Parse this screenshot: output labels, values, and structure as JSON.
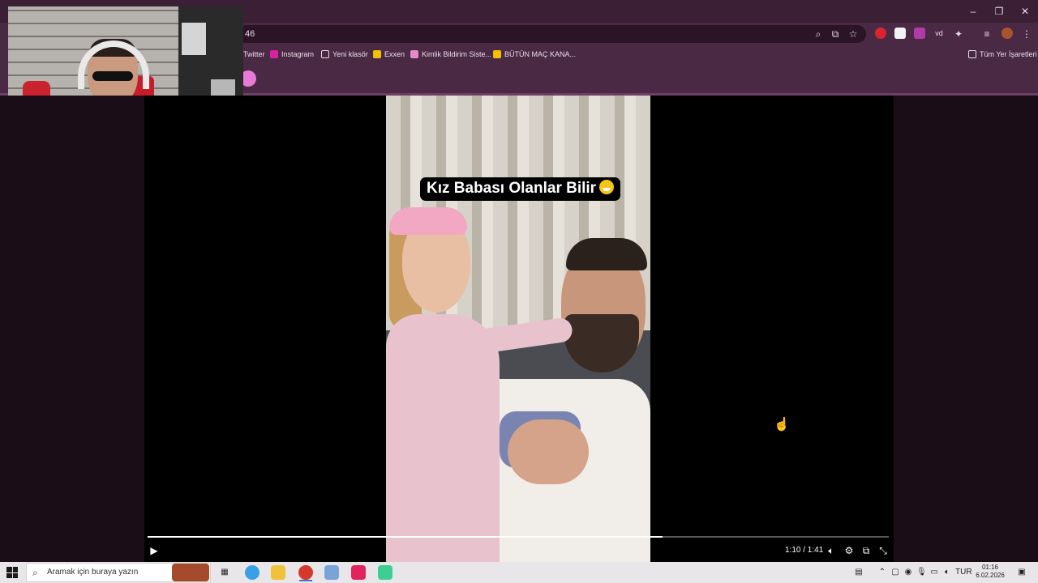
{
  "browser": {
    "address_fragment": "46",
    "window_controls": {
      "minimize": "–",
      "restore": "❐",
      "close": "✕"
    },
    "bookmarks": [
      {
        "label": "Twitter",
        "icon": "twitter-icon"
      },
      {
        "label": "Instagram",
        "icon": "instagram-icon",
        "color": "#d6249f"
      },
      {
        "label": "Yeni klasör",
        "icon": "folder-icon"
      },
      {
        "label": "Exxen",
        "icon": "exxen-icon",
        "color": "#f2c200"
      },
      {
        "label": "Kimlik Bildirim Siste...",
        "icon": "kimlik-icon",
        "color": "#e58bc7"
      },
      {
        "label": "BÜTÜN MAÇ KANA...",
        "icon": "jp-icon",
        "color": "#f2c200"
      }
    ],
    "all_bookmarks_label": "Tüm Yer İşaretleri"
  },
  "video": {
    "caption": "Kız Babası Olanlar Bilir",
    "time_display": "1:10 / 1:41",
    "progress_fraction": 0.695
  },
  "taskbar": {
    "search_placeholder": "Aramak için buraya yazın",
    "language": "TUR",
    "time": "01:16",
    "date": "6.02.2026"
  },
  "colors": {
    "chrome_bg": "#4a2944",
    "title_bg": "#3a1f35",
    "accent_pink": "#e77ad6",
    "taskbar_bg": "#e9e6ea"
  }
}
